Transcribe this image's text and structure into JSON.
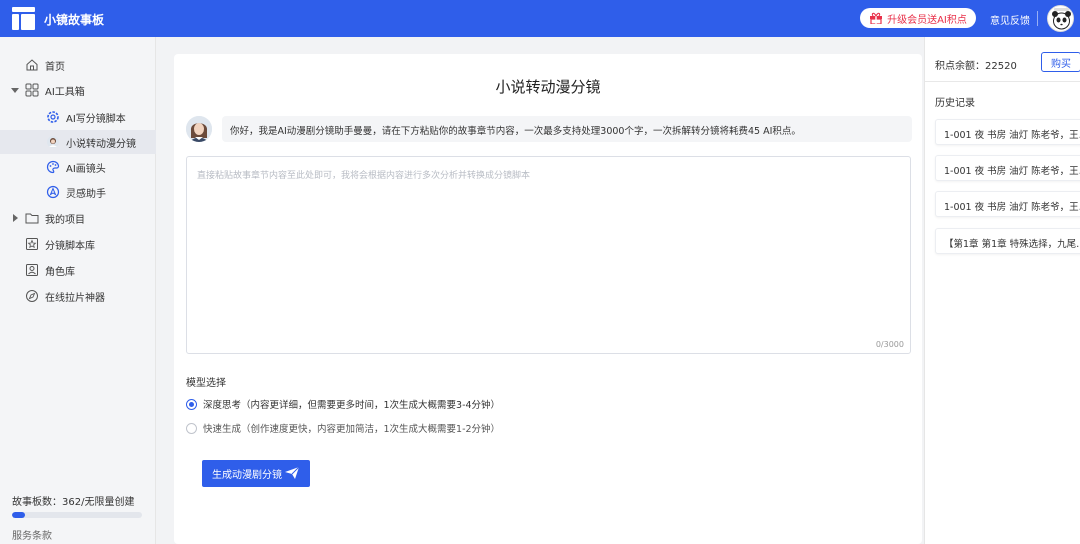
{
  "app": {
    "title": "小镜故事板"
  },
  "header": {
    "upgrade_label": "升级会员送AI积点",
    "feedback_label": "意见反馈"
  },
  "sidebar": {
    "items": [
      {
        "label": "首页"
      },
      {
        "label": "AI工具箱"
      },
      {
        "label": "AI写分镜脚本"
      },
      {
        "label": "小说转动漫分镜"
      },
      {
        "label": "AI画镜头"
      },
      {
        "label": "灵感助手"
      },
      {
        "label": "我的项目"
      },
      {
        "label": "分镜脚本库"
      },
      {
        "label": "角色库"
      },
      {
        "label": "在线拉片神器"
      }
    ],
    "quota_label": "故事板数：362/无限量创建",
    "quota_progress": 0.1,
    "terms_label": "服务条款"
  },
  "main": {
    "title": "小说转动漫分镜",
    "greeting": "你好，我是AI动漫剧分镜助手曼曼，请在下方粘贴你的故事章节内容，一次最多支持处理3000个字，一次拆解转分镜将耗费45 AI积点。",
    "textarea_placeholder": "直接粘贴故事章节内容至此处即可，我将会根据内容进行多次分析并转换成分镜脚本",
    "char_count": "0/3000",
    "model_label": "模型选择",
    "options": [
      {
        "label": "深度思考（内容更详细，但需要更多时间，1次生成大概需要3-4分钟）",
        "selected": true
      },
      {
        "label": "快速生成（创作速度更快，内容更加简洁，1次生成大概需要1-2分钟）",
        "selected": false
      }
    ],
    "generate_label": "生成动漫剧分镜"
  },
  "right": {
    "points_label": "积点余额：",
    "points_value": "22520",
    "buy_label": "购买",
    "history_title": "历史记录",
    "history": [
      "1-001 夜 书房 油灯 陈老爷，王…",
      "1-001 夜 书房 油灯 陈老爷，王…",
      "1-001 夜 书房 油灯 陈老爷，王…",
      "【第1章 第1章 特殊选择，九尾…"
    ]
  },
  "colors": {
    "brand": "#2f5eea",
    "upgrade_text": "#e8314a"
  }
}
